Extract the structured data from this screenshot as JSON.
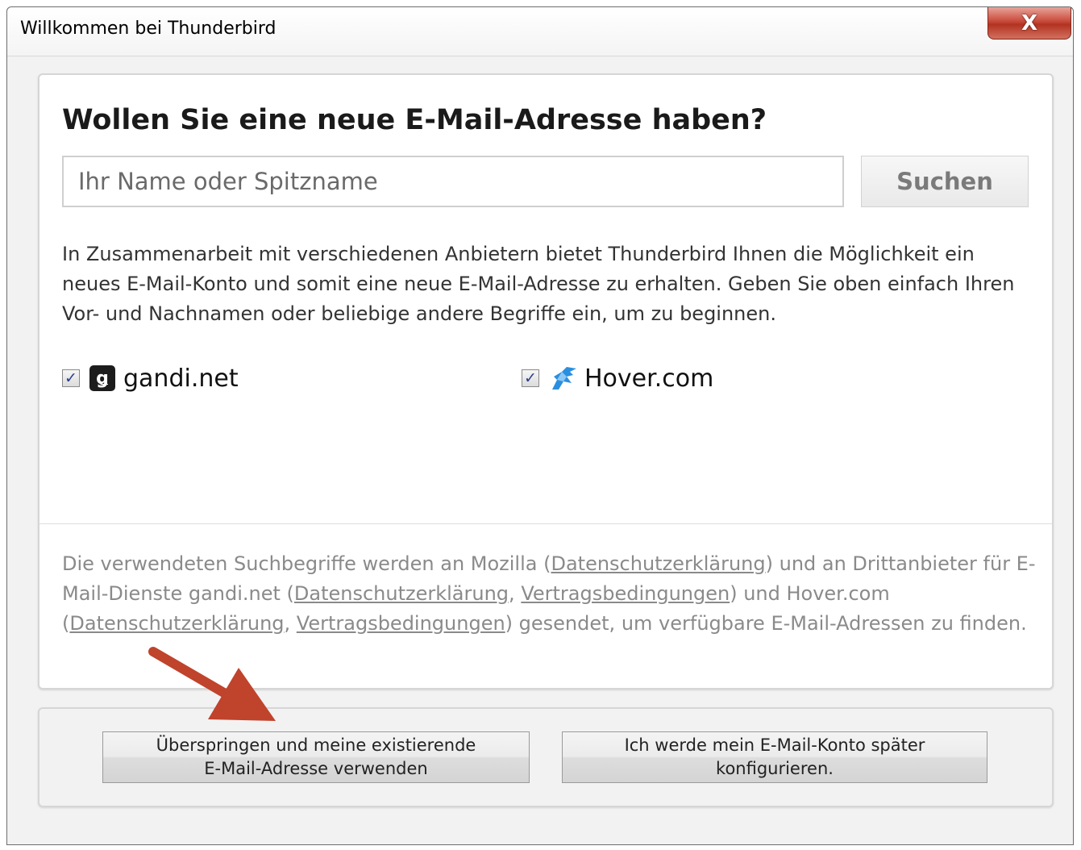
{
  "window": {
    "title": "Willkommen bei Thunderbird",
    "close_label": "X"
  },
  "main": {
    "headline": "Wollen Sie eine neue E-Mail-Adresse haben?",
    "search": {
      "placeholder": "Ihr Name oder Spitzname",
      "value": "",
      "button_label": "Suchen"
    },
    "description": "In Zusammenarbeit mit verschiedenen Anbietern bietet Thunderbird Ihnen die Möglichkeit ein neues E-Mail-Konto und somit eine neue E-Mail-Adresse zu erhalten. Geben Sie oben einfach Ihren Vor- und Nachnamen oder beliebige andere Begriffe ein, um zu beginnen.",
    "providers": [
      {
        "name": "gandi.net",
        "checked": true,
        "icon": "gandi-logo-icon",
        "logo_glyph": "ǥ"
      },
      {
        "name": "Hover.com",
        "checked": true,
        "icon": "hover-logo-icon"
      }
    ],
    "privacy": {
      "part1": "Die verwendeten Suchbegriffe werden an Mozilla (",
      "link_mozilla_privacy": "Datenschutzerklärung",
      "part2": ") und an Drittanbieter für E-Mail-Dienste gandi.net (",
      "link_gandi_privacy": "Datenschutzerklärung",
      "sep1": ", ",
      "link_gandi_terms": "Vertragsbedingungen",
      "part3": ") und Hover.com (",
      "link_hover_privacy": "Datenschutzerklärung",
      "sep2": ", ",
      "link_hover_terms": "Vertragsbedingungen",
      "part4": ") gesendet, um verfügbare E-Mail-Adressen zu finden."
    }
  },
  "footer": {
    "skip_button": "Überspringen und meine existierende\nE-Mail-Adresse verwenden",
    "later_button": "Ich werde mein E-Mail-Konto später\nkonfigurieren."
  },
  "colors": {
    "annotation_arrow": "#c0432c",
    "close_button": "#c8493a",
    "checkbox_mark": "#2b3f8c"
  }
}
